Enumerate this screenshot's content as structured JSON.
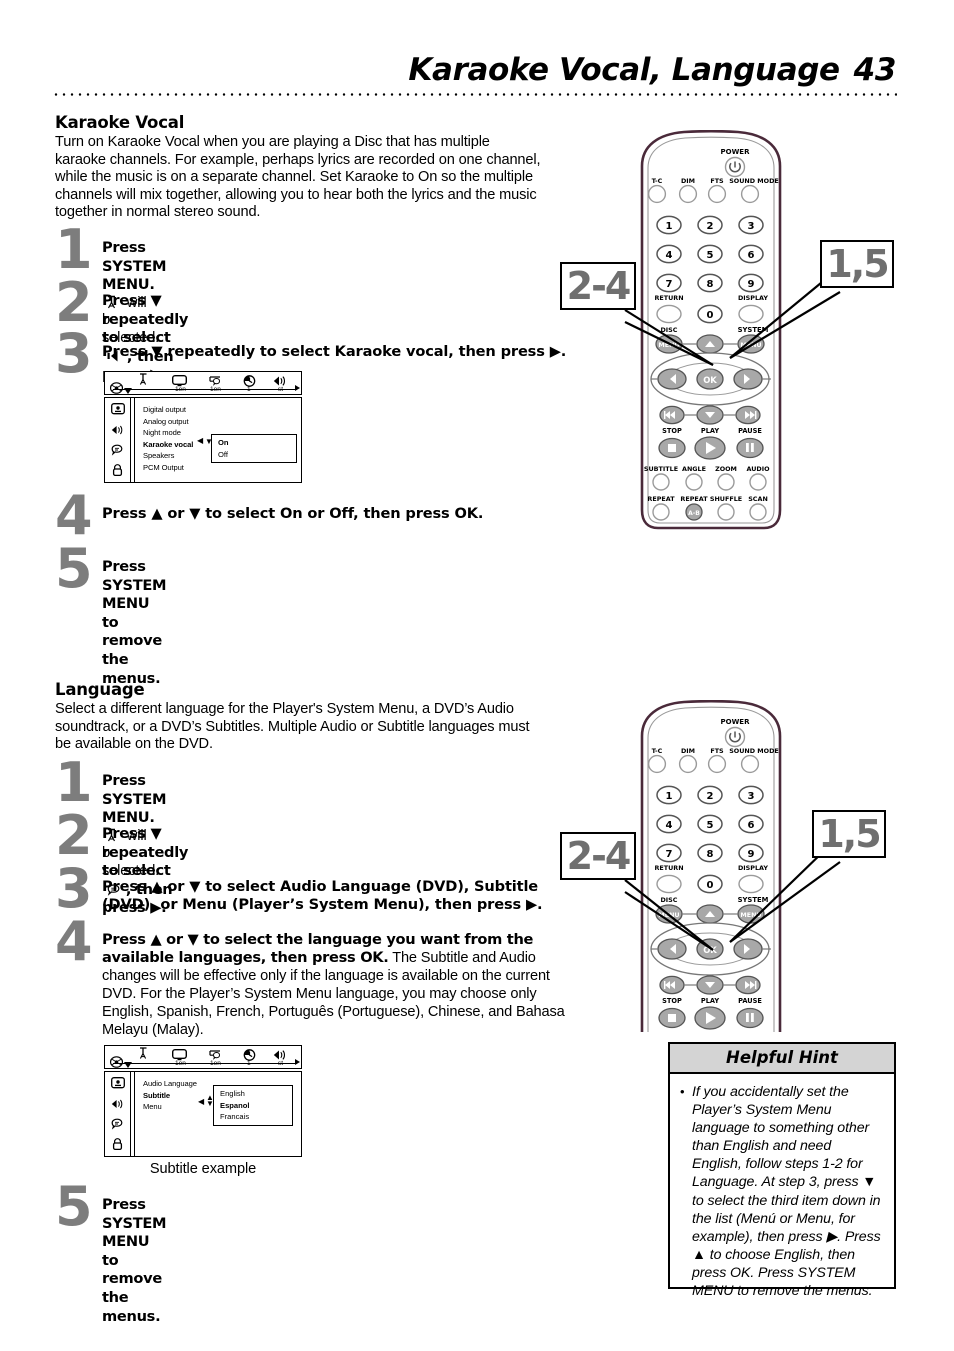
{
  "header": {
    "title": "Karaoke Vocal, Language",
    "page_number": "43"
  },
  "karaoke": {
    "heading": "Karaoke Vocal",
    "intro": "Turn on Karaoke Vocal when you are playing a Disc that has multiple karaoke channels. For example, perhaps lyrics are recorded on one channel, while the music is on a separate channel. Set Karaoke to On so the multiple channels will mix together, allowing you to hear both the lyrics and the music together in normal stereo sound.",
    "steps": [
      {
        "num": "1",
        "pre": "Press SYSTEM MENU.",
        "icon": "setup-icon",
        "post": "will be selected."
      },
      {
        "num": "2",
        "pre": "Press ▼ repeatedly to select",
        "icon": "speaker-icon",
        "post": ", then press ▶."
      },
      {
        "num": "3",
        "pre": "Press ▼ repeatedly to select Karaoke vocal, then press ▶.",
        "icon": "",
        "post": ""
      },
      {
        "num": "4",
        "pre": "Press ▲ or ▼ to select On or Off, then press OK.",
        "icon": "",
        "post": ""
      },
      {
        "num": "5",
        "pre": "Press SYSTEM MENU",
        "icon": "",
        "post": " to remove the menus.",
        "bold_pre": true
      }
    ],
    "osd": {
      "tabs": [
        {
          "icon": "disc-icon",
          "label": ""
        },
        {
          "icon": "setup-icon",
          "label": ""
        },
        {
          "icon": "screen-icon",
          "label": "1en"
        },
        {
          "icon": "subtitle-icon",
          "label": "1en"
        },
        {
          "icon": "clock-icon",
          "label": "1"
        },
        {
          "icon": "speaker-icon",
          "label": "st"
        }
      ],
      "sidebar_icons": [
        "screen-icon",
        "speaker-icon",
        "subtitle-icon",
        "lock-icon"
      ],
      "items": [
        {
          "label": "Digital output",
          "selected": false
        },
        {
          "label": "Analog output",
          "selected": false
        },
        {
          "label": "Night mode",
          "selected": false
        },
        {
          "label": "Karaoke vocal",
          "selected": true
        },
        {
          "label": "Speakers",
          "selected": false
        },
        {
          "label": "PCM Output",
          "selected": false
        }
      ],
      "submenu": [
        {
          "label": "On",
          "selected": true
        },
        {
          "label": "Off",
          "selected": false
        }
      ],
      "caption": ""
    },
    "callouts": [
      {
        "label": "2-4"
      },
      {
        "label": "1,5"
      }
    ]
  },
  "language": {
    "heading": "Language",
    "intro": "Select a different language for the Player's System Menu, a DVD’s Audio soundtrack, or a DVD’s Subtitles. Multiple Audio or Subtitle languages must be available on the DVD.",
    "steps": [
      {
        "num": "1",
        "pre": "Press SYSTEM MENU.",
        "icon": "setup-icon",
        "post": "will be selected."
      },
      {
        "num": "2",
        "pre": "Press ▼ repeatedly to select",
        "icon": "subtitle-icon",
        "post": ", then press ▶."
      },
      {
        "num": "3",
        "pre": "Press ▲ or ▼ to select Audio Language (DVD), Subtitle (DVD), or Menu (Player’s System Menu), then press ▶.",
        "icon": "",
        "post": ""
      },
      {
        "num": "4",
        "bold_part": "Press ▲ or ▼ to select the language you want from the available languages, then press OK.",
        "rest": " The Subtitle and Audio changes will be effective only if the language is available on the current DVD. For the Player’s System Menu language, you may choose only English, Spanish, French, Português (Portuguese), Chinese, and Bahasa Melayu (Malay)."
      },
      {
        "num": "5",
        "pre": "Press SYSTEM MENU",
        "icon": "",
        "post": " to remove the menus.",
        "bold_pre": true
      }
    ],
    "osd": {
      "tabs": [
        {
          "icon": "disc-icon",
          "label": ""
        },
        {
          "icon": "setup-icon",
          "label": ""
        },
        {
          "icon": "screen-icon",
          "label": "1en"
        },
        {
          "icon": "subtitle-icon",
          "label": "1en"
        },
        {
          "icon": "clock-icon",
          "label": "1"
        },
        {
          "icon": "speaker-icon",
          "label": "st"
        }
      ],
      "sidebar_icons": [
        "screen-icon",
        "speaker-icon",
        "subtitle-icon",
        "lock-icon"
      ],
      "items": [
        {
          "label": "Audio Language",
          "selected": false
        },
        {
          "label": "Subtitle",
          "selected": true
        },
        {
          "label": "Menu",
          "selected": false
        }
      ],
      "submenu": [
        {
          "label": "English",
          "selected": false
        },
        {
          "label": "Espanol",
          "selected": true
        },
        {
          "label": "Francais",
          "selected": false
        }
      ],
      "caption": "Subtitle example"
    },
    "callouts": [
      {
        "label": "2-4"
      },
      {
        "label": "1,5"
      }
    ]
  },
  "remote": {
    "power_label": "POWER",
    "row_top": [
      "T-C",
      "DIM",
      "FTS",
      "SOUND MODE"
    ],
    "keypad": [
      "1",
      "2",
      "3",
      "4",
      "5",
      "6",
      "7",
      "8",
      "9",
      "0"
    ],
    "return_label": "RETURN",
    "display_label": "DISPLAY",
    "disc_menu_label": "DISC",
    "system_menu_label": "SYSTEM",
    "menu_btn_label": "MENU",
    "ok_label": "OK",
    "transport_labels": [
      "STOP",
      "PLAY",
      "PAUSE"
    ],
    "feature_row1": [
      "SUBTITLE",
      "ANGLE",
      "ZOOM",
      "AUDIO"
    ],
    "feature_row2": [
      "REPEAT",
      "REPEAT",
      "SHUFFLE",
      "SCAN"
    ],
    "repeat_ab_label": "A-B"
  },
  "hint": {
    "title": "Helpful Hint",
    "body": "If you accidentally set the Player’s System Menu language to something other than English and need English, follow steps 1-2 for Language. At step 3, press ▼ to select the third item down in the list (Menú or Menu, for example), then press ▶. Press ▲ to choose English, then press OK. Press SYSTEM MENU to remove the menus."
  },
  "colors": {
    "step_number": "#7d7d7d",
    "hint_header_bg": "#d4d4d4",
    "remote_button": "#a8a8a8",
    "text": "#000000"
  }
}
